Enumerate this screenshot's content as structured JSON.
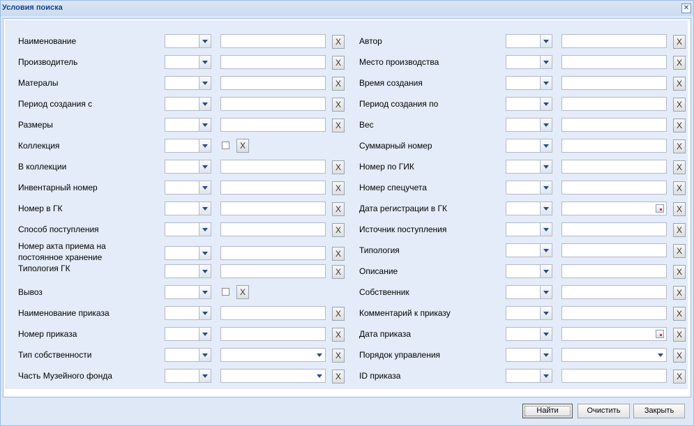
{
  "window": {
    "title": "Условия поиска",
    "close_glyph": "✕"
  },
  "left_fields": [
    {
      "label": "Наименование",
      "type": "text"
    },
    {
      "label": "Производитель",
      "type": "text"
    },
    {
      "label": "Матералы",
      "type": "text"
    },
    {
      "label": "Период создания с",
      "type": "text"
    },
    {
      "label": "Размеры",
      "type": "text"
    },
    {
      "label": "Коллекция",
      "type": "checkbox"
    },
    {
      "label": "В коллекции",
      "type": "text"
    },
    {
      "label": "Инвентарный номер",
      "type": "text"
    },
    {
      "label": "Номер в ГК",
      "type": "text"
    },
    {
      "label": "Способ поступления",
      "type": "text"
    },
    {
      "label": "Номер акта приема на постоянное хранение",
      "type": "text"
    },
    {
      "label": "Типология ГК",
      "type": "text"
    },
    {
      "label": "Вывоз",
      "type": "checkbox"
    },
    {
      "label": "Наименование приказа",
      "type": "text"
    },
    {
      "label": "Номер приказа",
      "type": "text"
    },
    {
      "label": "Тип собственности",
      "type": "select"
    },
    {
      "label": "Часть Музейного фонда",
      "type": "select"
    }
  ],
  "right_fields": [
    {
      "label": "Автор",
      "type": "text"
    },
    {
      "label": "Место производства",
      "type": "text"
    },
    {
      "label": "Время создания",
      "type": "text"
    },
    {
      "label": "Период создания по",
      "type": "text"
    },
    {
      "label": "Вес",
      "type": "text"
    },
    {
      "label": "Суммарный номер",
      "type": "text"
    },
    {
      "label": "Номер по ГИК",
      "type": "text"
    },
    {
      "label": "Номер спецучета",
      "type": "text"
    },
    {
      "label": "Дата регистрации в ГК",
      "type": "date"
    },
    {
      "label": "Источник поступления",
      "type": "text"
    },
    {
      "label": "Типология",
      "type": "text"
    },
    {
      "label": "Описание",
      "type": "text"
    },
    {
      "label": "Собственник",
      "type": "text"
    },
    {
      "label": "Комментарий к приказу",
      "type": "text"
    },
    {
      "label": "Дата приказа",
      "type": "date"
    },
    {
      "label": "Порядок управления",
      "type": "select"
    },
    {
      "label": "ID приказа",
      "type": "text"
    }
  ],
  "clear_field_glyph": "X",
  "buttons": {
    "find": "Найти",
    "clear": "Очистить",
    "close": "Закрыть"
  }
}
